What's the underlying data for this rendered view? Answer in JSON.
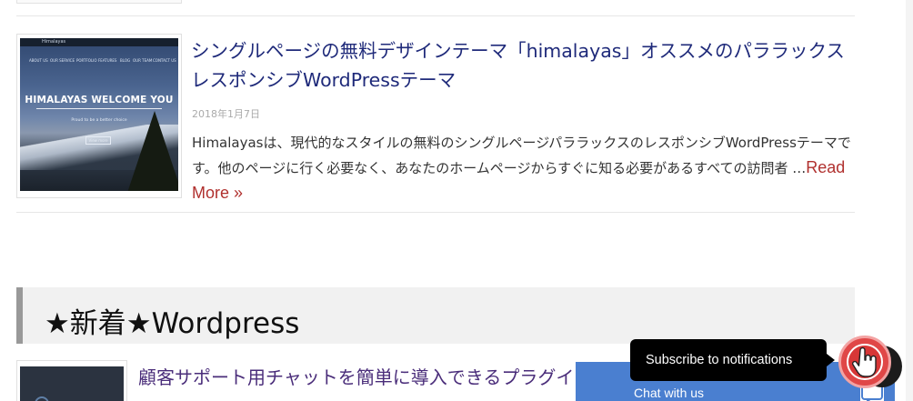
{
  "previous_article": {},
  "article": {
    "title": "シングルページの無料デザインテーマ「himalayas」オススメのパララックスレスポンシブWordPressテーマ",
    "date": "2018年1月7日",
    "excerpt": "Himalayasは、現代的なスタイルの無料のシングルページパララックスのレスポンシブWordPressテーマです。他のページに行く必要なく、あなたのホームページからすぐに知る必要があるすべての訪問者 …",
    "read_more": "Read More »",
    "thumbnail": {
      "heading": "HIMALAYAS WELCOME YOU",
      "tagline": "Proud to be a better choice",
      "button": "View more",
      "top_bar": "Himalayas",
      "nav": [
        "ABOUT US",
        "OUR SERVICE",
        "PORTFOLIO",
        "FEATURES",
        "BLOG",
        "OUR TEAM",
        "CONTACT US"
      ]
    }
  },
  "section": {
    "heading": "★新着★Wordpress"
  },
  "next_article": {
    "title": "顧客サポート用チャットを簡単に導入できるプラグイン"
  },
  "chat_widget": {
    "label": "Chat with us",
    "tooltip": "Subscribe to notifications",
    "colors": {
      "bar": "#4a7fd0",
      "bell": "#e04747",
      "tooltip": "#000000"
    }
  },
  "icons": {
    "bell": "bell-icon",
    "chat": "chat-bubble-icon",
    "cursor": "hand-pointer-icon"
  }
}
